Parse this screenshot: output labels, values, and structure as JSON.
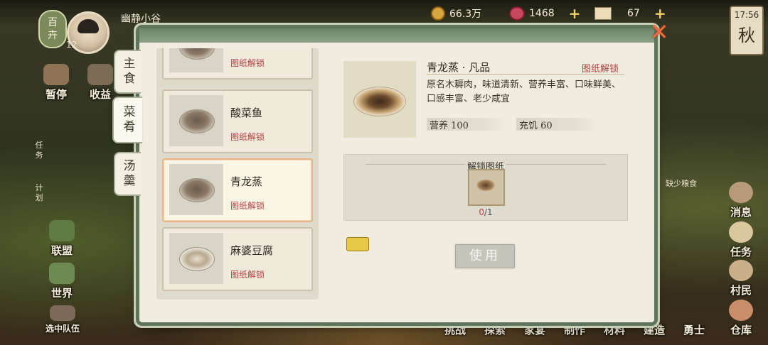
{
  "hud": {
    "season_chip": [
      "百",
      "卉"
    ],
    "level": "12",
    "village_name": "幽静小谷",
    "copper": "66.3万",
    "gems": "1468",
    "scrolls": "67",
    "plus": "+",
    "time": "17:56",
    "season": "秋"
  },
  "left_menu": {
    "pause": "暂停",
    "collect": "收益",
    "task_v": "任务",
    "plan_v": "计划",
    "alliance": "联盟",
    "world": "世界",
    "team": "选中队伍"
  },
  "right_menu": {
    "message": "消息",
    "tasks": "任务",
    "villagers": "村民",
    "warehouse": "仓库",
    "fog_text": "缺少粮食"
  },
  "bottom_nav": [
    "挑战",
    "探索",
    "家宴",
    "制作",
    "材料",
    "建造",
    "勇士"
  ],
  "tabs": {
    "staple": "主食",
    "dishes": "菜肴",
    "soup": "汤羹"
  },
  "recipes": [
    {
      "name": "",
      "status": "图纸解锁"
    },
    {
      "name": "酸菜鱼",
      "status": "图纸解锁"
    },
    {
      "name": "青龙蒸",
      "status": "图纸解锁"
    },
    {
      "name": "麻婆豆腐",
      "status": "图纸解锁"
    }
  ],
  "detail": {
    "title": "青龙蒸 · 凡品",
    "unlock_status": "图纸解锁",
    "description": "原名木耨肉，味道清新、营养丰富、口味鲜美、口感丰富、老少咸宜",
    "nutrition": "营养 100",
    "satiety": "充饥 60",
    "unlock_heading": "解锁图纸",
    "blueprint_owned": "0",
    "blueprint_needed": "/1",
    "use_button": "使用"
  }
}
